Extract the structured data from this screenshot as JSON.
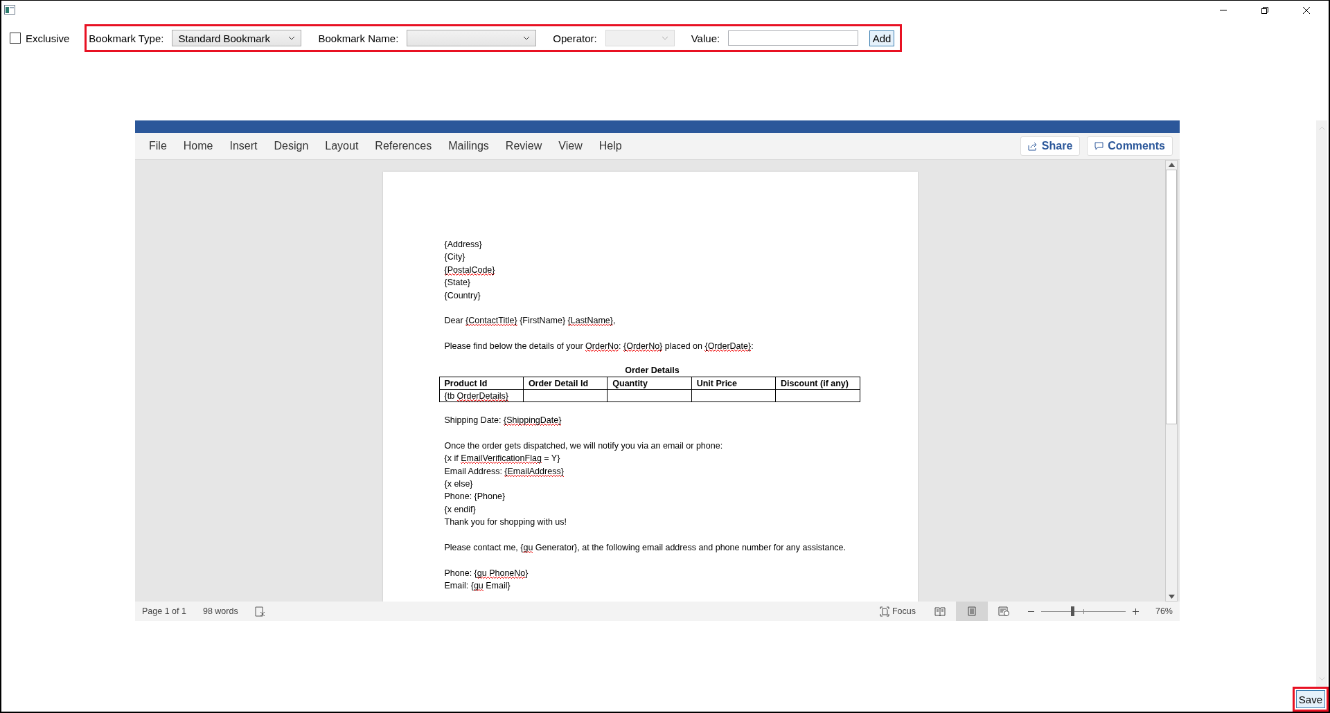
{
  "toolbar": {
    "exclusive": {
      "label": "Exclusive",
      "checked": false
    },
    "fields": [
      {
        "kind": "dropdown",
        "label": "Bookmark Type:",
        "value": "Standard Bookmark",
        "disabled": false
      },
      {
        "kind": "dropdown",
        "label": "Bookmark Name:",
        "disabled": false
      },
      {
        "kind": "dropdown",
        "label": "Operator:",
        "disabled": true
      },
      {
        "kind": "text",
        "label": "Value:"
      }
    ],
    "add_button": "Add"
  },
  "word": {
    "ribbon_tabs": [
      "File",
      "Home",
      "Insert",
      "Design",
      "Layout",
      "References",
      "Mailings",
      "Review",
      "View",
      "Help"
    ],
    "share_button": "Share",
    "comments_button": "Comments",
    "document": [
      {
        "kind": "paragraph",
        "lines": [
          [
            {
              "text": "{Address}",
              "flagged": false
            }
          ],
          [
            {
              "text": "{City}",
              "flagged": false
            }
          ],
          [
            {
              "text": "{PostalCode}",
              "flagged": true
            }
          ],
          [
            {
              "text": "{State}",
              "flagged": false
            }
          ],
          [
            {
              "text": "{Country}",
              "flagged": false
            }
          ]
        ]
      },
      {
        "kind": "paragraph",
        "lines": [
          [
            {
              "text": "Dear ",
              "flagged": false
            },
            {
              "text": "{ContactTitle}",
              "flagged": true
            },
            {
              "text": " {FirstName} ",
              "flagged": false
            },
            {
              "text": "{LastName}",
              "flagged": true
            },
            {
              "text": ",",
              "flagged": false
            }
          ]
        ]
      },
      {
        "kind": "paragraph",
        "lines": [
          [
            {
              "text": "Please find below the details of your ",
              "flagged": false
            },
            {
              "text": "OrderNo",
              "flagged": true
            },
            {
              "text": ": ",
              "flagged": false
            },
            {
              "text": "{OrderNo}",
              "flagged": true
            },
            {
              "text": " placed on ",
              "flagged": false
            },
            {
              "text": "{OrderDate}",
              "flagged": true
            },
            {
              "text": ":",
              "flagged": false
            }
          ]
        ]
      },
      {
        "kind": "table",
        "title": "Order Details",
        "columns": [
          "Product Id",
          "Order Detail Id",
          "Quantity",
          "Unit Price",
          "Discount (if any)"
        ],
        "rows": [
          [
            [
              {
                "text": "{tb ",
                "flagged": false
              },
              {
                "text": "OrderDetails}",
                "flagged": true
              }
            ],
            [],
            [],
            [],
            []
          ]
        ]
      },
      {
        "kind": "paragraph",
        "lines": [
          [
            {
              "text": "Shipping Date: ",
              "flagged": false
            },
            {
              "text": "{ShippingDate}",
              "flagged": true
            }
          ]
        ]
      },
      {
        "kind": "paragraph",
        "lines": [
          [
            {
              "text": "Once the order gets dispatched, we will notify you via an email or phone:",
              "flagged": false
            }
          ],
          [
            {
              "text": "{x if ",
              "flagged": false
            },
            {
              "text": "EmailVerificationFlag",
              "flagged": true
            },
            {
              "text": " = Y}",
              "flagged": false
            }
          ],
          [
            {
              "text": "Email Address: ",
              "flagged": false
            },
            {
              "text": "{EmailAddress}",
              "flagged": true
            }
          ],
          [
            {
              "text": "{x else}",
              "flagged": false
            }
          ],
          [
            {
              "text": "Phone: {Phone}",
              "flagged": false
            }
          ],
          [
            {
              "text": "{x endif}",
              "flagged": false
            }
          ],
          [
            {
              "text": "Thank you for shopping with us!",
              "flagged": false
            }
          ]
        ]
      },
      {
        "kind": "paragraph",
        "lines": [
          [
            {
              "text": "Please contact me, {",
              "flagged": false
            },
            {
              "text": "gu",
              "flagged": true
            },
            {
              "text": " Generator}, at the following email address and phone number for any assistance.",
              "flagged": false
            }
          ]
        ]
      },
      {
        "kind": "paragraph",
        "lines": [
          [
            {
              "text": "Phone: {",
              "flagged": false
            },
            {
              "text": "gu PhoneNo",
              "flagged": true
            },
            {
              "text": "}",
              "flagged": false
            }
          ],
          [
            {
              "text": "Email: {",
              "flagged": false
            },
            {
              "text": "gu",
              "flagged": true
            },
            {
              "text": " Email}",
              "flagged": false
            }
          ]
        ]
      }
    ],
    "status_bar": {
      "page": "Page 1 of 1",
      "words": "98 words",
      "focus": "Focus",
      "views": [
        {
          "kind": "read",
          "selected": false
        },
        {
          "kind": "print",
          "selected": true
        },
        {
          "kind": "web",
          "selected": false
        }
      ],
      "zoom": {
        "level": 0.37,
        "reading": "76%"
      }
    }
  },
  "save_button": "Save"
}
